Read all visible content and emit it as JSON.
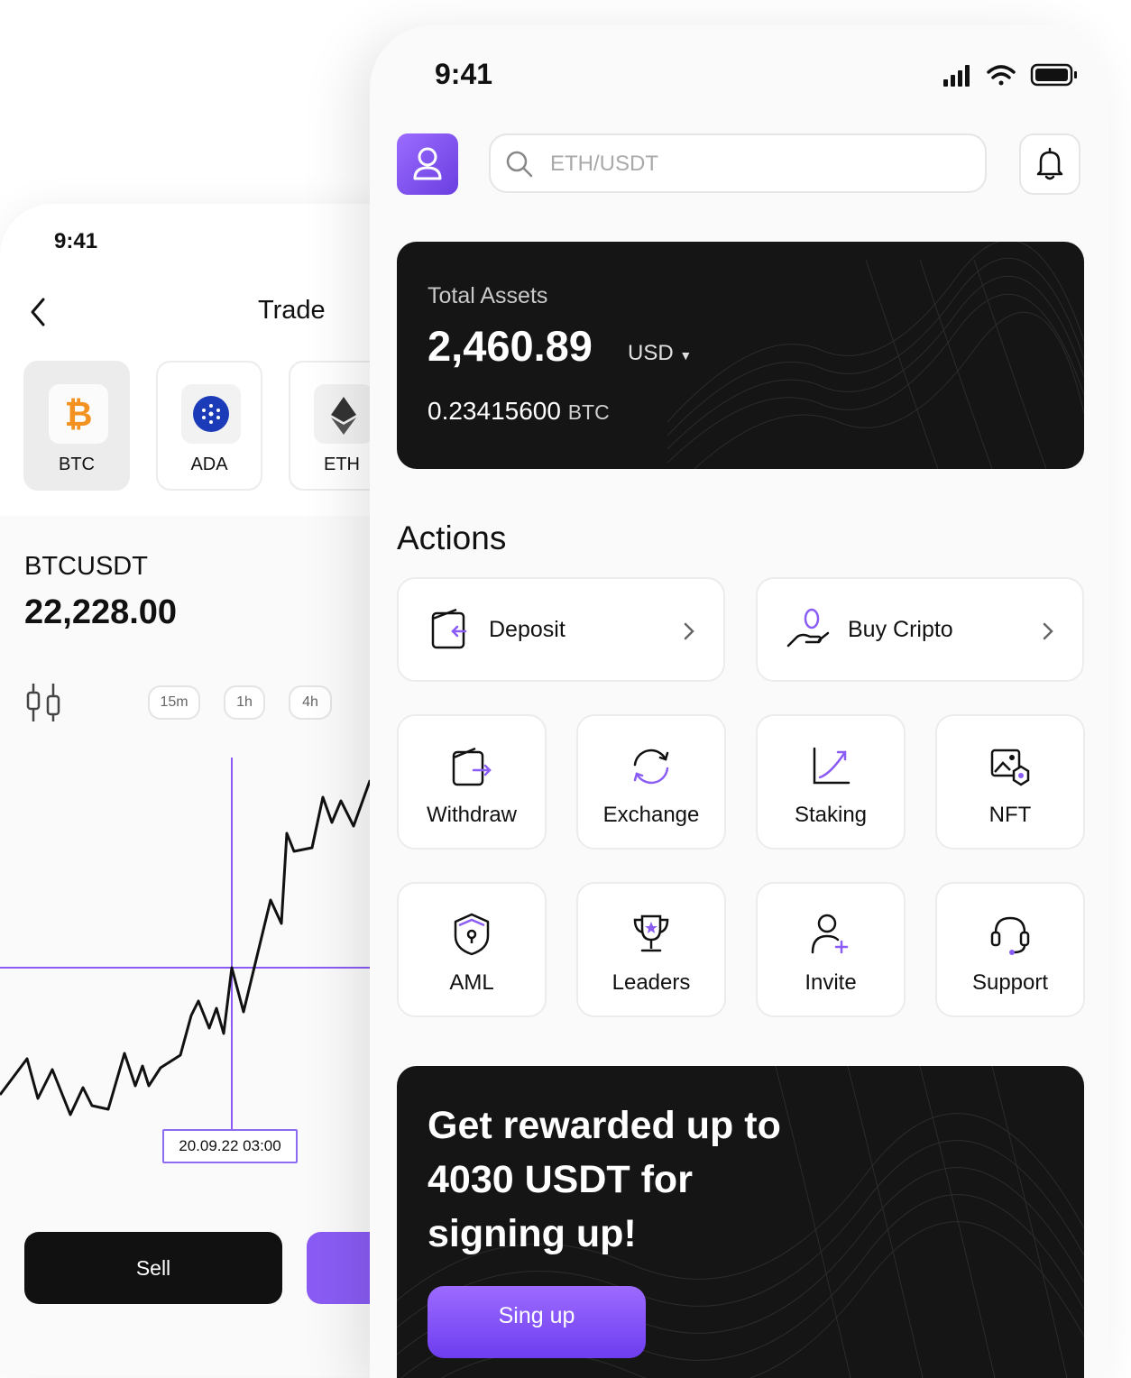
{
  "trade_screen": {
    "status_time": "9:41",
    "title": "Trade",
    "coins": [
      {
        "symbol": "BTC",
        "icon": "bitcoin-icon"
      },
      {
        "symbol": "ADA",
        "icon": "cardano-icon"
      },
      {
        "symbol": "ETH",
        "icon": "ethereum-icon"
      }
    ],
    "pair": "BTCUSDT",
    "price": "22,228.00",
    "timeframes": [
      "15m",
      "1h",
      "4h"
    ],
    "crosshair_date": "20.09.22 03:00",
    "sell_label": "Sell",
    "accent": "#8a5cf5"
  },
  "home_screen": {
    "status_time": "9:41",
    "search_placeholder": "ETH/USDT",
    "assets": {
      "title": "Total Assets",
      "value": "2,460.89",
      "currency": "USD",
      "btc_value": "0.23415600",
      "btc_unit": "BTC"
    },
    "actions_title": "Actions",
    "wide_actions": [
      {
        "label": "Deposit",
        "icon": "wallet-in-icon"
      },
      {
        "label": "Buy Cripto",
        "icon": "coin-hand-icon"
      }
    ],
    "tiles": [
      {
        "label": "Withdraw",
        "icon": "wallet-out-icon"
      },
      {
        "label": "Exchange",
        "icon": "exchange-icon"
      },
      {
        "label": "Staking",
        "icon": "growth-chart-icon"
      },
      {
        "label": "NFT",
        "icon": "nft-image-icon"
      },
      {
        "label": "AML",
        "icon": "shield-lock-icon"
      },
      {
        "label": "Leaders",
        "icon": "trophy-icon"
      },
      {
        "label": "Invite",
        "icon": "user-plus-icon"
      },
      {
        "label": "Support",
        "icon": "headset-icon"
      }
    ],
    "promo": {
      "line1": "Get rewarded up to",
      "line2": "4030 USDT for",
      "line3": "signing up!",
      "button": "Sing up"
    },
    "accent": "#8a5cf5"
  }
}
